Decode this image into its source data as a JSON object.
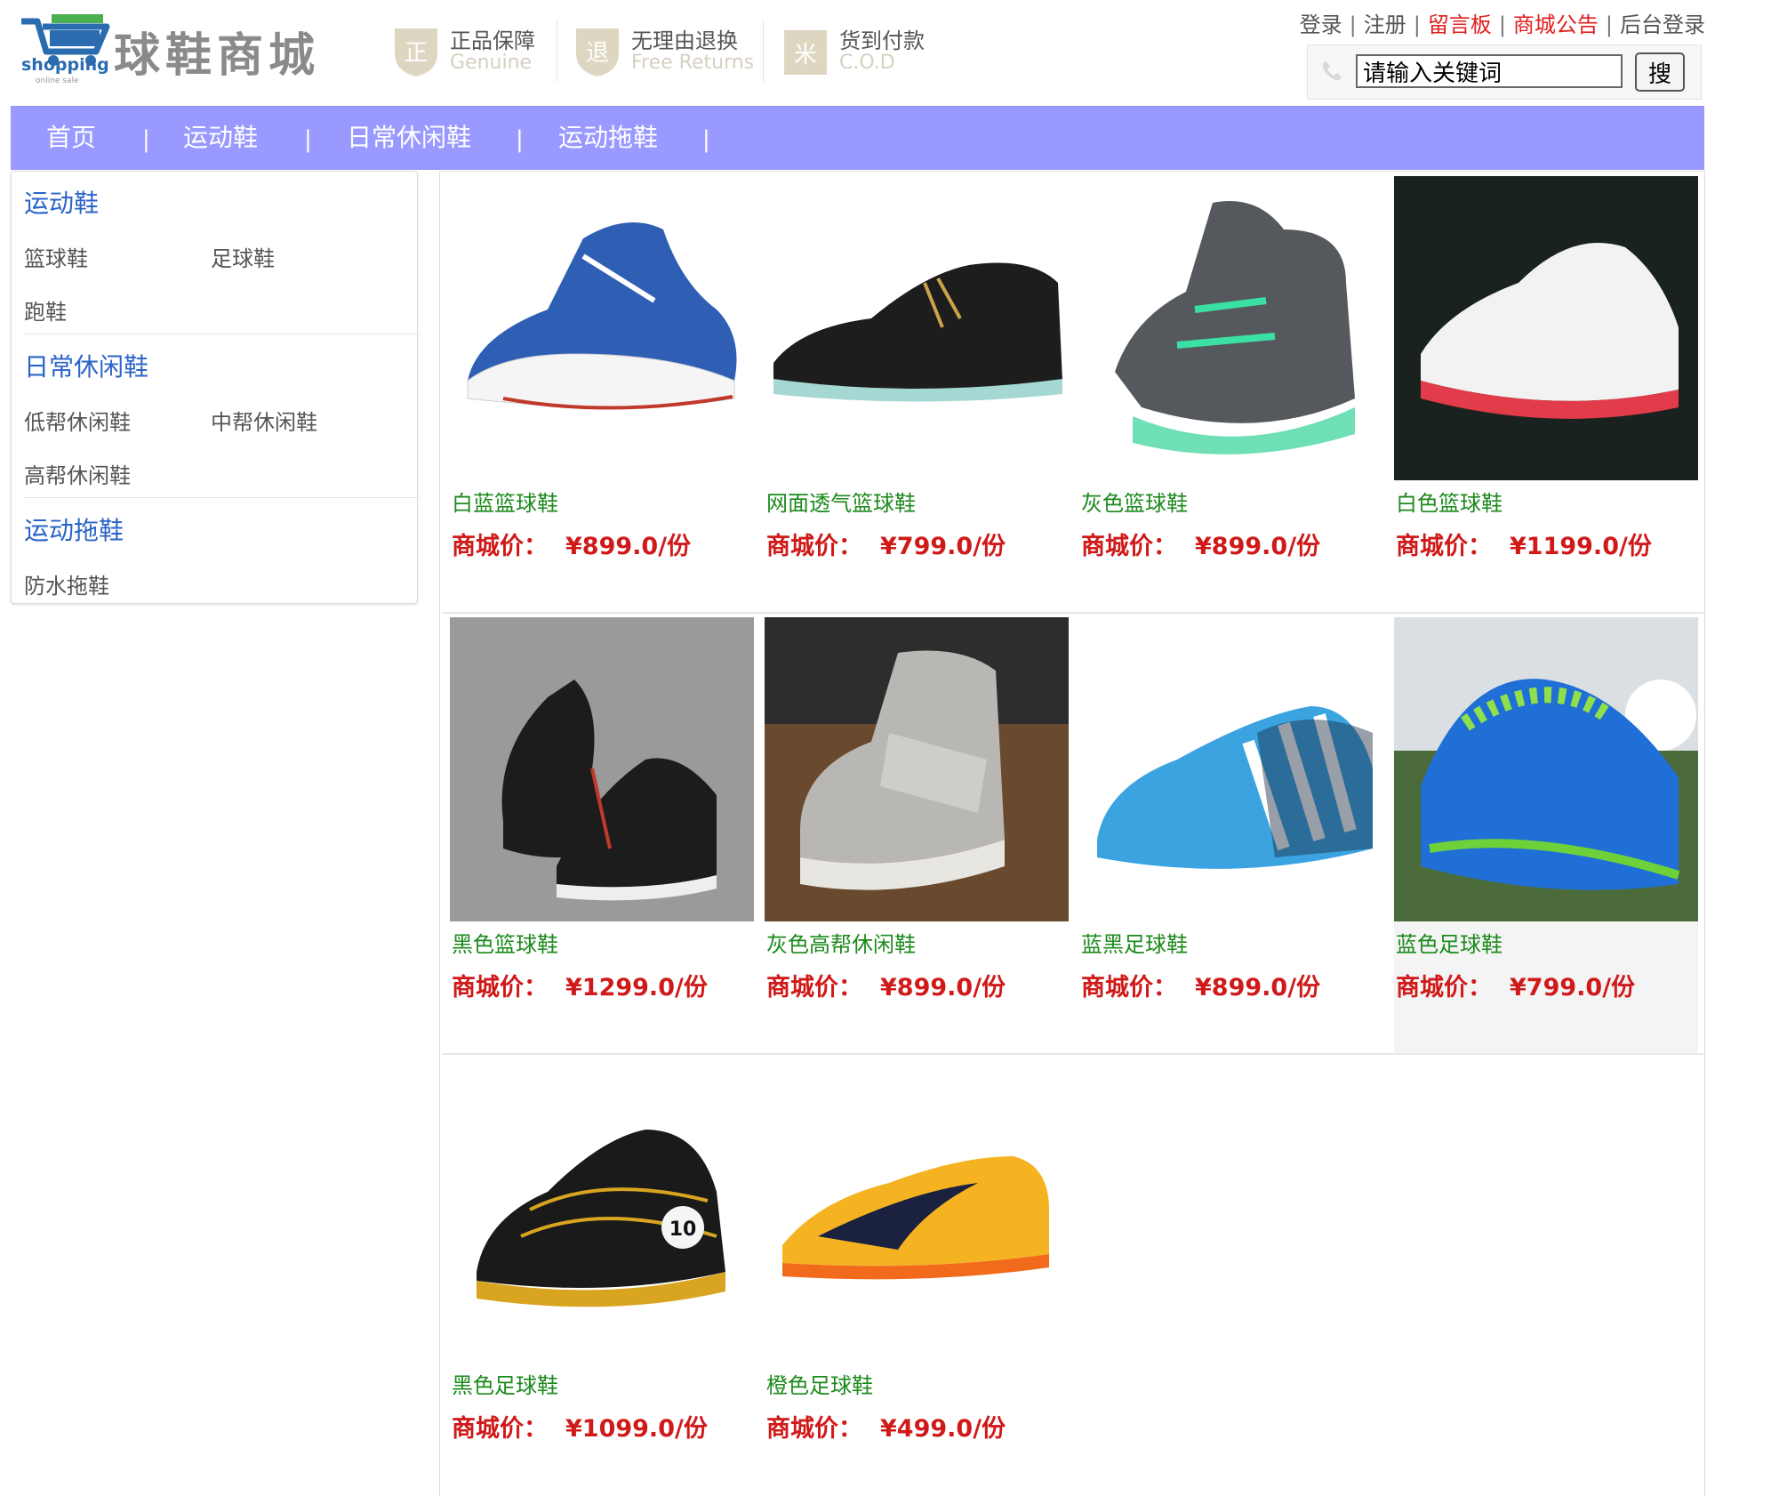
{
  "header": {
    "logo_text": "shopping",
    "logo_sub": "online sale",
    "site_title": "球鞋商城",
    "badges": [
      {
        "cn": "正品保障",
        "en": "Genuine",
        "glyph": "正",
        "icon": "genuine-shield-icon"
      },
      {
        "cn": "无理由退换",
        "en": "Free Returns",
        "glyph": "退",
        "icon": "returns-shield-icon"
      },
      {
        "cn": "货到付款",
        "en": "C.O.D",
        "glyph": "米",
        "icon": "cod-gift-icon"
      }
    ],
    "links": {
      "login": "登录",
      "register": "注册",
      "message_board": "留言板",
      "announcement": "商城公告",
      "admin_login": "后台登录",
      "sep": "|"
    },
    "search": {
      "value": "请输入关键词",
      "button": "搜"
    }
  },
  "nav": {
    "items": [
      "首页",
      "运动鞋",
      "日常休闲鞋",
      "运动拖鞋"
    ],
    "sep": "|"
  },
  "sidebar": {
    "categories": [
      {
        "title": "运动鞋",
        "items": [
          "篮球鞋",
          "足球鞋",
          "跑鞋"
        ]
      },
      {
        "title": "日常休闲鞋",
        "items": [
          "低帮休闲鞋",
          "中帮休闲鞋",
          "高帮休闲鞋"
        ]
      },
      {
        "title": "运动拖鞋",
        "items": [
          "防水拖鞋"
        ]
      }
    ]
  },
  "price_label": "商城价：",
  "products": [
    {
      "name": "白蓝篮球鞋",
      "price": "¥899.0/份"
    },
    {
      "name": "网面透气篮球鞋",
      "price": "¥799.0/份"
    },
    {
      "name": "灰色篮球鞋",
      "price": "¥899.0/份"
    },
    {
      "name": "白色篮球鞋",
      "price": "¥1199.0/份"
    },
    {
      "name": "黑色篮球鞋",
      "price": "¥1299.0/份"
    },
    {
      "name": "灰色高帮休闲鞋",
      "price": "¥899.0/份"
    },
    {
      "name": "蓝黑足球鞋",
      "price": "¥899.0/份"
    },
    {
      "name": "蓝色足球鞋",
      "price": "¥799.0/份"
    },
    {
      "name": "黑色足球鞋",
      "price": "¥1099.0/份"
    },
    {
      "name": "橙色足球鞋",
      "price": "¥499.0/份"
    }
  ],
  "colors": {
    "nav_bg": "#9999ff",
    "category_blue": "#2a64c8",
    "product_name_green": "#1c8a1c",
    "price_red": "#d01a1a",
    "link_red": "#e02020"
  }
}
